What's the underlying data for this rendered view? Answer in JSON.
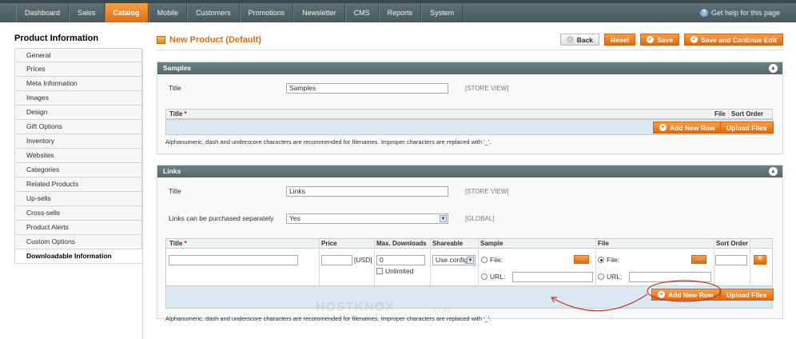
{
  "nav": {
    "items": [
      "Dashboard",
      "Sales",
      "Catalog",
      "Mobile",
      "Customers",
      "Promotions",
      "Newsletter",
      "CMS",
      "Reports",
      "System"
    ],
    "active": "Catalog",
    "help": "Get help for this page"
  },
  "sidebar": {
    "title": "Product Information",
    "tabs": [
      "General",
      "Prices",
      "Meta Information",
      "Images",
      "Design",
      "Gift Options",
      "Inventory",
      "Websites",
      "Categories",
      "Related Products",
      "Up-sells",
      "Cross-sells",
      "Product Alerts",
      "Custom Options",
      "Downloadable Information"
    ],
    "active": "Downloadable Information"
  },
  "header": {
    "title": "New Product (Default)",
    "back": "Back",
    "reset": "Reset",
    "save": "Save",
    "save_continue": "Save and Continue Edit"
  },
  "samples": {
    "heading": "Samples",
    "title_label": "Title",
    "title_value": "Samples",
    "scope": "[STORE VIEW]",
    "grid": {
      "col_title": "Title",
      "req": "*",
      "col_file": "File",
      "col_sort": "Sort Order"
    },
    "add_row": "Add New Row",
    "upload": "Upload Files",
    "note": "Alphanumeric, dash and underscore characters are recommended for filenames. Improper characters are replaced with '_'."
  },
  "links": {
    "heading": "Links",
    "title_label": "Title",
    "title_value": "Links",
    "title_scope": "[STORE VIEW]",
    "separate_label": "Links can be purchased separately",
    "separate_value": "Yes",
    "separate_scope": "[GLOBAL]",
    "grid": {
      "col_title": "Title",
      "req": "*",
      "col_price": "Price",
      "col_downloads": "Max. Downloads",
      "col_shareable": "Shareable",
      "col_sample": "Sample",
      "col_file": "File",
      "col_sort": "Sort Order"
    },
    "row": {
      "currency": "[USD]",
      "downloads": "0",
      "unlimited": "Unlimited",
      "shareable": "Use config",
      "file_label": "File:",
      "url_label": "URL:",
      "browse": "..."
    },
    "add_row": "Add New Row",
    "upload": "Upload Files",
    "note": "Alphanumeric, dash and underscore characters are recommended for filenames. Improper characters are replaced with '_'."
  },
  "watermark": {
    "brand": "HOSTKNOX",
    "domain": ".COM"
  },
  "colors": {
    "accent": "#e36d0c",
    "header_bg": "#5f7075",
    "annotation": "#c0392b"
  }
}
